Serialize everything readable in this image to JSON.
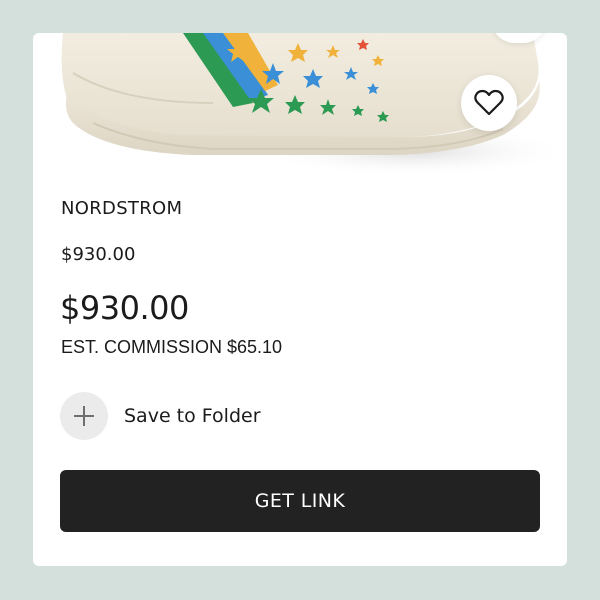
{
  "product": {
    "retailer": "NORDSTROM",
    "price_original": "$930.00",
    "price": "$930.00",
    "commission": "EST. COMMISSION $65.10"
  },
  "actions": {
    "save_to_folder_label": "Save to Folder",
    "get_link_label": "GET LINK"
  },
  "icons": {
    "favorite": "heart-icon",
    "save": "plus-icon"
  },
  "colors": {
    "page_background": "#d3e0dc",
    "card_background": "#ffffff",
    "button_background": "#222222",
    "button_text": "#ffffff",
    "plus_circle_background": "#ebebeb"
  }
}
